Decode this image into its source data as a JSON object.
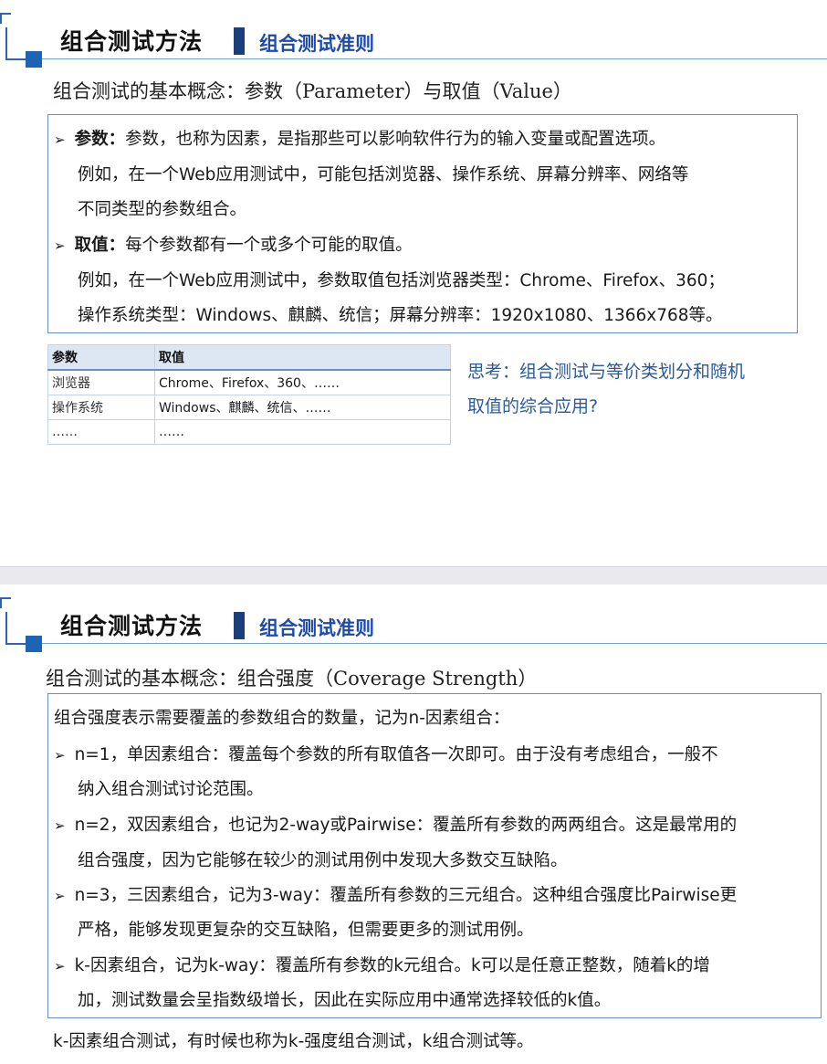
{
  "slide1": {
    "title": "组合测试方法",
    "subtitle": "组合测试准则",
    "concept": "组合测试的基本概念：参数（Parameter）与取值（Value）",
    "param_label": "参数：",
    "param_text": "参数，也称为因素，是指那些可以影响软件行为的输入变量或配置选项。",
    "param_ex1": "例如，在一个Web应用测试中，可能包括浏览器、操作系统、屏幕分辨率、网络等",
    "param_ex2": "不同类型的参数组合。",
    "value_label": "取值：",
    "value_text": "每个参数都有一个或多个可能的取值。",
    "value_ex1": "例如，在一个Web应用测试中，参数取值包括浏览器类型：Chrome、Firefox、360；",
    "value_ex2": "操作系统类型：Windows、麒麟、统信；屏幕分辨率：1920x1080、1366x768等。",
    "table": {
      "headers": [
        "参数",
        "取值"
      ],
      "rows": [
        [
          "浏览器",
          "Chrome、Firefox、360、……"
        ],
        [
          "操作系统",
          "Windows、麒麟、统信、……"
        ],
        [
          "……",
          "……"
        ]
      ]
    },
    "think1": "思考：组合测试与等价类划分和随机",
    "think2": "取值的综合应用?"
  },
  "slide2": {
    "title": "组合测试方法",
    "subtitle": "组合测试准则",
    "concept": "组合测试的基本概念：组合强度（Coverage Strength）",
    "intro": "组合强度表示需要覆盖的参数组合的数量，记为n-因素组合：",
    "b1a": "n=1，单因素组合：覆盖每个参数的所有取值各一次即可。由于没有考虑组合，一般不",
    "b1b": "纳入组合测试讨论范围。",
    "b2a": "n=2，双因素组合，也记为2-way或Pairwise：覆盖所有参数的两两组合。这是最常用的",
    "b2b": "组合强度，因为它能够在较少的测试用例中发现大多数交互缺陷。",
    "b3a": "n=3，三因素组合，记为3-way：覆盖所有参数的三元组合。这种组合强度比Pairwise更",
    "b3b": "严格，能够发现更复杂的交互缺陷，但需要更多的测试用例。",
    "b4a": "k-因素组合，记为k-way：覆盖所有参数的k元组合。k可以是任意正整数，随着k的增",
    "b4b": "加，测试数量会呈指数级增长，因此在实际应用中通常选择较低的k值。",
    "footer": "k-因素组合测试，有时候也称为k-强度组合测试，k组合测试等。"
  }
}
